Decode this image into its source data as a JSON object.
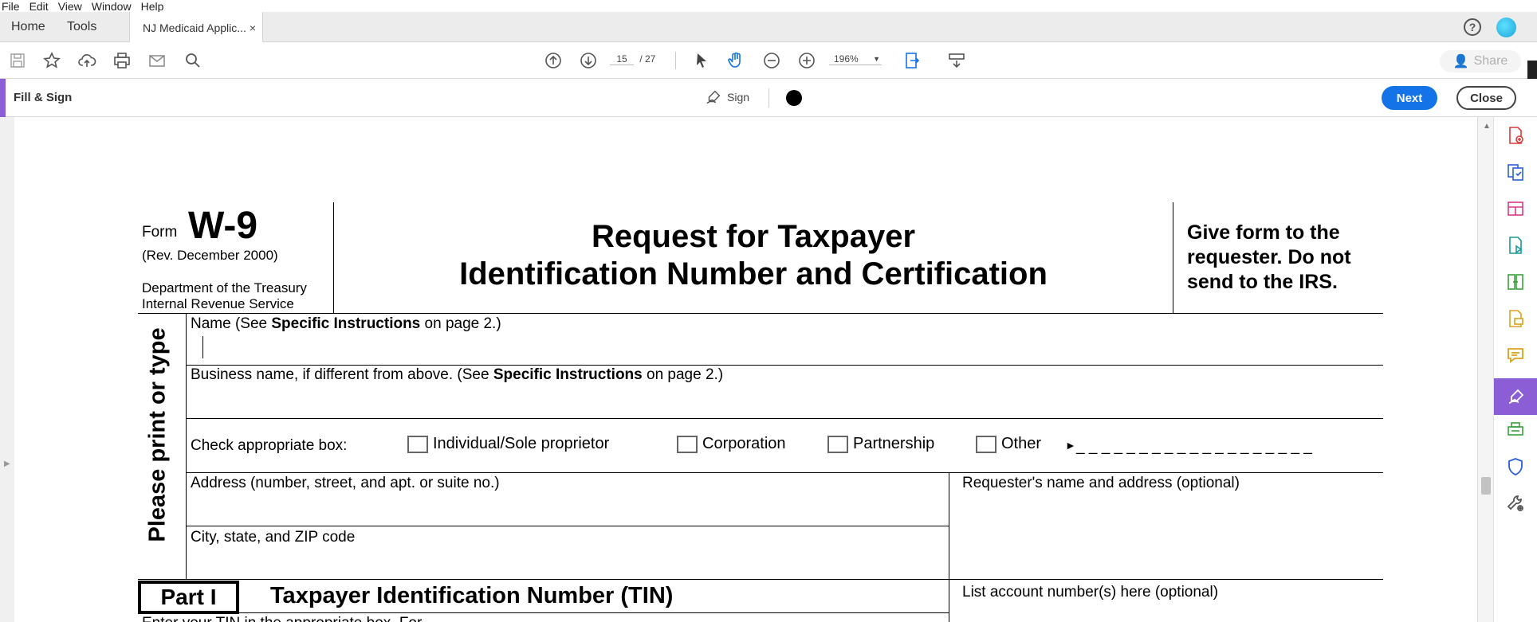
{
  "menu": [
    "File",
    "Edit",
    "View",
    "Window",
    "Help"
  ],
  "tabs": {
    "home": "Home",
    "tools": "Tools",
    "document": "NJ Medicaid Applic...",
    "close": "×"
  },
  "toolbar": {
    "page_current": "15",
    "page_total": "/ 27",
    "zoom": "196%",
    "share_label": "Share"
  },
  "fillsign": {
    "title": "Fill & Sign",
    "sign_label": "Sign",
    "next_label": "Next",
    "close_label": "Close",
    "ink_color": "#000000"
  },
  "form": {
    "form_word": "Form",
    "form_number": "W-9",
    "revision": "(Rev. December 2000)",
    "dept_line1": "Department of the Treasury",
    "dept_line2": "Internal Revenue Service",
    "title_line1": "Request for Taxpayer",
    "title_line2": "Identification Number and Certification",
    "give_line1": "Give form to the",
    "give_line2": "requester. Do not",
    "give_line3": "send to the IRS.",
    "vertical_label": "Please print or type",
    "name_pre": "Name (See ",
    "name_bold": "Specific Instructions",
    "name_post": " on page 2.)",
    "biz_pre": "Business name, if different from above. (See ",
    "biz_bold": "Specific Instructions",
    "biz_post": " on page 2.)",
    "check_label": "Check appropriate box:",
    "opt_individual": "Individual/Sole proprietor",
    "opt_corporation": "Corporation",
    "opt_partnership": "Partnership",
    "opt_other": "Other",
    "other_blank": "_ _ _ _ _ _ _ _ _ _ _ _ _ _ _ _ _ _ _",
    "address_label": "Address (number, street, and apt. or suite no.)",
    "requester_label": "Requester's name and address (optional)",
    "city_label": "City, state, and ZIP code",
    "part_label": "Part I",
    "tin_heading": "Taxpayer Identification Number (TIN)",
    "account_label": "List account number(s) here (optional)",
    "tin_instructions": "Enter your TIN in the appropriate box.  For"
  },
  "colors": {
    "accent_purple": "#8c5ed6",
    "button_blue": "#1473e6"
  }
}
